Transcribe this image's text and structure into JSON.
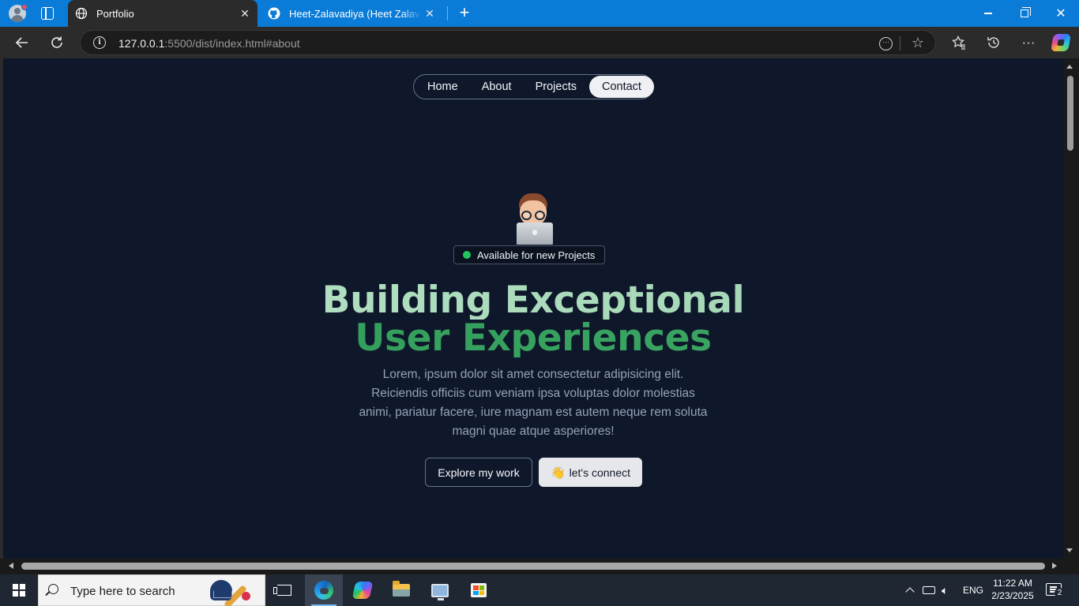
{
  "browser": {
    "tabs": [
      {
        "title": "Portfolio",
        "favicon": "globe-icon",
        "active": true
      },
      {
        "title": "Heet-Zalavadiya (Heet Zalavadiya)",
        "favicon": "github-icon",
        "active": false
      }
    ],
    "address": {
      "host": "127.0.0.1",
      "rest": ":5500/dist/index.html#about"
    }
  },
  "site": {
    "nav": [
      "Home",
      "About",
      "Projects",
      "Contact"
    ],
    "nav_active": "Contact",
    "badge": "Available for new Projects",
    "headline_line1": "Building Exceptional",
    "headline_line2": "User Experiences",
    "intro": "Lorem, ipsum dolor sit amet consectetur adipisicing elit. Reiciendis officiis cum veniam ipsa voluptas dolor molestias animi, pariatur facere, iure magnam est autem neque rem soluta magni quae atque asperiores!",
    "buttons": {
      "explore": "Explore my work",
      "connect": "let's connect",
      "connect_emoji": "👋"
    },
    "colors": {
      "background": "#0f172a",
      "headline_light": "#a8dbbb",
      "headline_dark": "#35a05e",
      "status_green": "#22c55e"
    }
  },
  "taskbar": {
    "search_placeholder": "Type here to search",
    "language": "ENG",
    "time": "11:22 AM",
    "date": "2/23/2025",
    "notification_count": "2",
    "pinned": [
      "task-view-icon",
      "edge-icon",
      "microsoft-365-icon",
      "file-explorer-icon",
      "remote-desktop-icon",
      "microsoft-store-icon"
    ]
  }
}
